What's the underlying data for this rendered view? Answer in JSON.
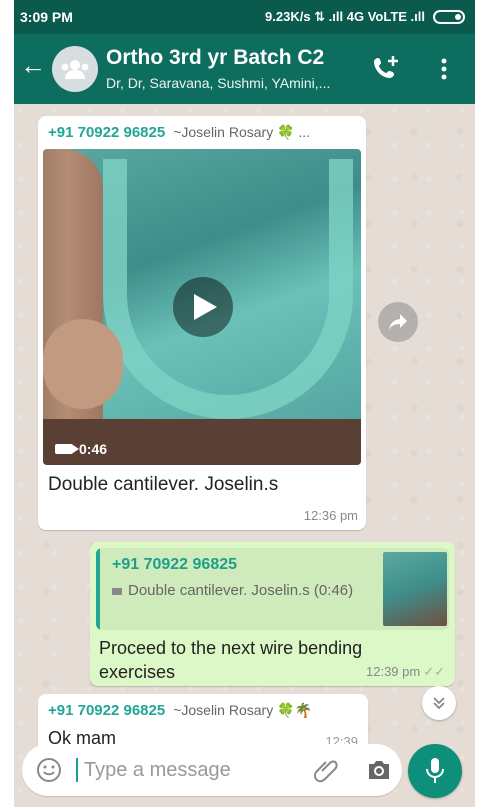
{
  "status_bar": {
    "time": "3:09 PM",
    "network": "9.23K/s ⇅ .ıll 4G VoLTE .ıll"
  },
  "header": {
    "back_icon": "arrow-left-icon",
    "title": "Ortho 3rd yr Batch C2",
    "subtitle": "Dr, Dr, Saravana, Sushmi, YAmini,...",
    "avatar_icon": "group-icon"
  },
  "messages": [
    {
      "sender_number": "+91 70922 96825",
      "sender_name": "~Joselin Rosary 🍀 ...",
      "media_duration": "0:46",
      "caption": "Double cantilever.  Joselin.s",
      "time": "12:36 pm"
    },
    {
      "quoted_sender": "+91 70922 96825",
      "quoted_text": "Double cantilever.  Joselin.s (0:46)",
      "text": "Proceed to the next wire bending exercises",
      "time": "12:39 pm",
      "ticks": "✓✓"
    },
    {
      "sender_number": "+91 70922 96825",
      "sender_name": "~Joselin Rosary 🍀🌴",
      "text": "Ok mam",
      "time": "12:39"
    }
  ],
  "composer": {
    "placeholder": "Type a message"
  },
  "colors": {
    "status_bar": "#0a5a4d",
    "header": "#0d6e5f",
    "sender": "#22a694",
    "outgoing_bubble": "#dcf8c6",
    "mic_button": "#0d8f7c"
  }
}
